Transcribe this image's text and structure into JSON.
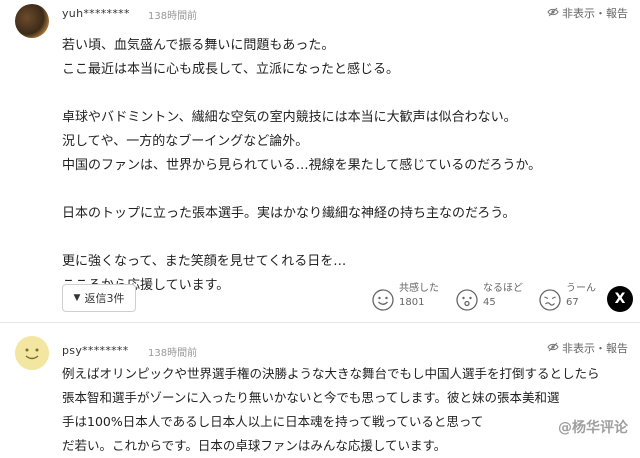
{
  "comment1": {
    "username": "yuh********",
    "time": "138時間前",
    "hide_label": "非表示・報告",
    "lines": [
      "若い頃、血気盛んで振る舞いに問題もあった。",
      "ここ最近は本当に心も成長して、立派になったと感じる。",
      "",
      "卓球やバドミントン、繊細な空気の室内競技には本当に大歓声は似合わない。",
      "況してや、一方的なブーイングなど論外。",
      "中国のファンは、世界から見られている…視線を果たして感じているのだろうか。",
      "",
      "日本のトップに立った張本選手。実はかなり繊細な神経の持ち主なのだろう。",
      "",
      "更に強くなって、また笑顔を見せてくれる日を…",
      "こころから応援しています。"
    ],
    "reply_label": "返信3件",
    "reactions": [
      {
        "label": "共感した",
        "count": "1801"
      },
      {
        "label": "なるほど",
        "count": "45"
      },
      {
        "label": "うーん",
        "count": "67"
      }
    ],
    "share_label": "X"
  },
  "comment2": {
    "username": "psy********",
    "time": "138時間前",
    "hide_label": "非表示・報告",
    "lines": [
      "例えばオリンピックや世界選手権の決勝ような大きな舞台でもし中国人選手を打倒するとしたら",
      "張本智和選手がゾーンに入ったり無いかないと今でも思ってします。彼と妹の張本美和選",
      "手は100%日本人であるし日本人以上に日本魂を持って戦っていると思って",
      "だ若い。これからです。日本の卓球ファンはみんな応援しています。"
    ]
  },
  "watermark": "@杨华评论"
}
